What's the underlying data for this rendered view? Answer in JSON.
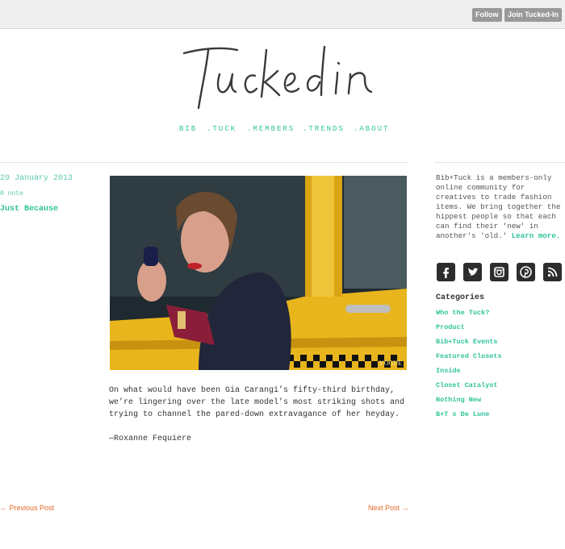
{
  "topbar": {
    "follow_label": "Follow",
    "join_label": "Join Tucked-In"
  },
  "logo": {
    "text": "Tucked in"
  },
  "nav": [
    {
      "label": "BIB"
    },
    {
      "label": ".TUCK"
    },
    {
      "label": ".MEMBERS"
    },
    {
      "label": ".TRENDS"
    },
    {
      "label": ".ABOUT"
    }
  ],
  "post": {
    "date": "29 January 2013",
    "notes": "0 note",
    "title": "Just Because",
    "photo_watermark": "VOGUE",
    "paragraphs": [
      "On what would have been Gia Carangi’s fifty-third birthday, we’re lingering over the late model’s most striking shots and trying to channel the pared-down extravagance of her heyday.",
      "—Roxanne Fequiere"
    ]
  },
  "pager": {
    "prev": "← Previous Post",
    "next": "Next Post →"
  },
  "sidebar": {
    "about_text": "Bib+Tuck is a members-only online community for creatives to trade fashion items. We bring together the hippest people so that each can find their 'new' in another's 'old.'",
    "about_link": "Learn more.",
    "social_icons": [
      "facebook-icon",
      "twitter-icon",
      "instagram-icon",
      "pinterest-icon",
      "rss-icon"
    ],
    "categories_heading": "Categories",
    "categories": [
      "Who the Tuck?",
      "Product",
      "Bib+Tuck Events",
      "Featured Closets",
      "Inside",
      "Closet Catalyst",
      "Nothing New",
      "B+T x De Lune"
    ]
  },
  "colors": {
    "accent": "#2fc49b",
    "link_orange": "#e0682a",
    "taxi_yellow": "#e8b51c"
  }
}
